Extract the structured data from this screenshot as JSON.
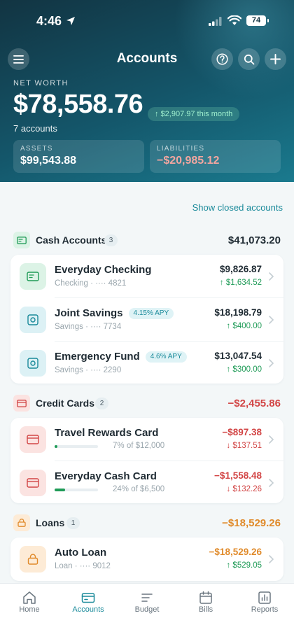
{
  "status": {
    "time": "4:46",
    "battery": "74"
  },
  "header": {
    "title": "Accounts"
  },
  "net_worth": {
    "label": "NET WORTH",
    "value": "$78,558.76",
    "change": "↑ $2,907.97 this month",
    "accounts_count": "7 accounts"
  },
  "assets": {
    "label": "ASSETS",
    "value": "$99,543.88"
  },
  "liabilities": {
    "label": "LIABILITIES",
    "value": "−$20,985.12"
  },
  "show_closed": "Show closed accounts",
  "sections": {
    "cash": {
      "name": "Cash Accounts",
      "count": "3",
      "total": "$41,073.20",
      "rows": [
        {
          "title": "Everyday Checking",
          "sub": "Checking · ···· 4821",
          "amount": "$9,826.87",
          "change": "↑ $1,634.52"
        },
        {
          "title": "Joint Savings",
          "apy": "4.15% APY",
          "sub": "Savings · ···· 7734",
          "amount": "$18,198.79",
          "change": "↑ $400.00"
        },
        {
          "title": "Emergency Fund",
          "apy": "4.6% APY",
          "sub": "Savings · ···· 2290",
          "amount": "$13,047.54",
          "change": "↑ $300.00"
        }
      ]
    },
    "credit": {
      "name": "Credit Cards",
      "count": "2",
      "total": "−$2,455.86",
      "rows": [
        {
          "title": "Travel Rewards Card",
          "util_text": "7% of $12,000",
          "utilization": 0.07,
          "amount": "−$897.38",
          "change": "↓ $137.51"
        },
        {
          "title": "Everyday Cash Card",
          "util_text": "24% of $6,500",
          "utilization": 0.24,
          "amount": "−$1,558.48",
          "change": "↓ $132.26"
        }
      ]
    },
    "loans": {
      "name": "Loans",
      "count": "1",
      "total": "−$18,529.26",
      "rows": [
        {
          "title": "Auto Loan",
          "sub": "Loan · ···· 9012",
          "amount": "−$18,529.26",
          "change": "↑ $529.05"
        }
      ]
    }
  },
  "tabs": [
    {
      "label": "Home",
      "icon": "home-icon"
    },
    {
      "label": "Accounts",
      "icon": "card-icon",
      "active": true
    },
    {
      "label": "Budget",
      "icon": "budget-icon"
    },
    {
      "label": "Bills",
      "icon": "calendar-icon"
    },
    {
      "label": "Reports",
      "icon": "chart-icon"
    }
  ],
  "colors": {
    "accent": "#1a8a9a",
    "positive": "#1f9b57",
    "negative": "#d24545",
    "loan": "#e08a2a"
  }
}
